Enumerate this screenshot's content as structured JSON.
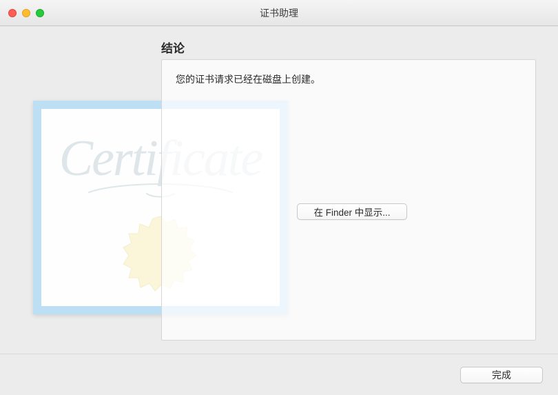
{
  "window": {
    "title": "证书助理"
  },
  "page": {
    "heading": "结论",
    "message": "您的证书请求已经在磁盘上创建。",
    "finder_button": "在 Finder 中显示...",
    "done_button": "完成"
  },
  "graphic": {
    "watermark": "Certificate"
  }
}
